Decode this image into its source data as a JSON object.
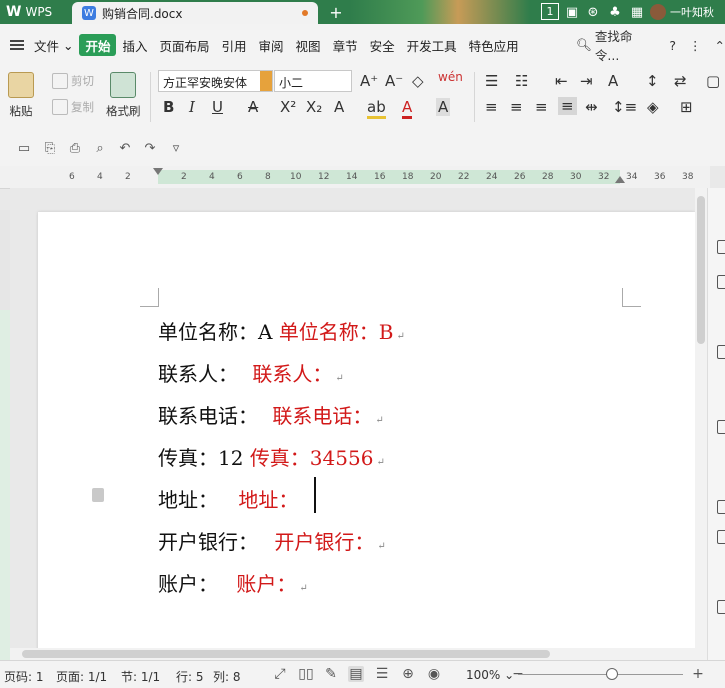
{
  "titlebar": {
    "app_name": "WPS",
    "doc_tab": "购销合同.docx",
    "tab_count": "1",
    "user_name": "一叶知秋"
  },
  "menu": {
    "file": "文件",
    "items": [
      "开始",
      "插入",
      "页面布局",
      "引用",
      "审阅",
      "视图",
      "章节",
      "安全",
      "开发工具",
      "特色应用"
    ],
    "search": "查找命令..."
  },
  "ribbon": {
    "paste": "粘贴",
    "cut": "剪切",
    "copy": "复制",
    "format_painter": "格式刷",
    "font_name": "方正罕安晚安体",
    "font_size": "小二"
  },
  "ruler": {
    "ticks": [
      "6",
      "4",
      "2",
      "2",
      "4",
      "6",
      "8",
      "10",
      "12",
      "14",
      "16",
      "18",
      "20",
      "22",
      "24",
      "26",
      "28",
      "30",
      "32",
      "34",
      "36",
      "38"
    ]
  },
  "document": {
    "lines": [
      {
        "black": "单位名称：A",
        "red": "单位名称：B",
        "mark": "↵"
      },
      {
        "black": "联系人：",
        "red": "联系人：",
        "mark": "↵"
      },
      {
        "black": "联系电话：",
        "red": "联系电话：",
        "mark": "↵"
      },
      {
        "black": "传真：12",
        "red": "传真：34556",
        "mark": "↵"
      },
      {
        "black": "地址：",
        "red": "地址：",
        "mark": ""
      },
      {
        "black": "开户银行：",
        "red": "开户银行：",
        "mark": "↵"
      },
      {
        "black": "账户：",
        "red": "账户：",
        "mark": "↵"
      }
    ]
  },
  "statusbar": {
    "page_no": "页码: 1",
    "pages": "页面: 1/1",
    "section": "节: 1/1",
    "row": "行: 5",
    "col": "列: 8",
    "zoom": "100%"
  },
  "colors": {
    "accent": "#2a9d57",
    "titlebar": "#2f7d4b",
    "red_text": "#d21919"
  }
}
